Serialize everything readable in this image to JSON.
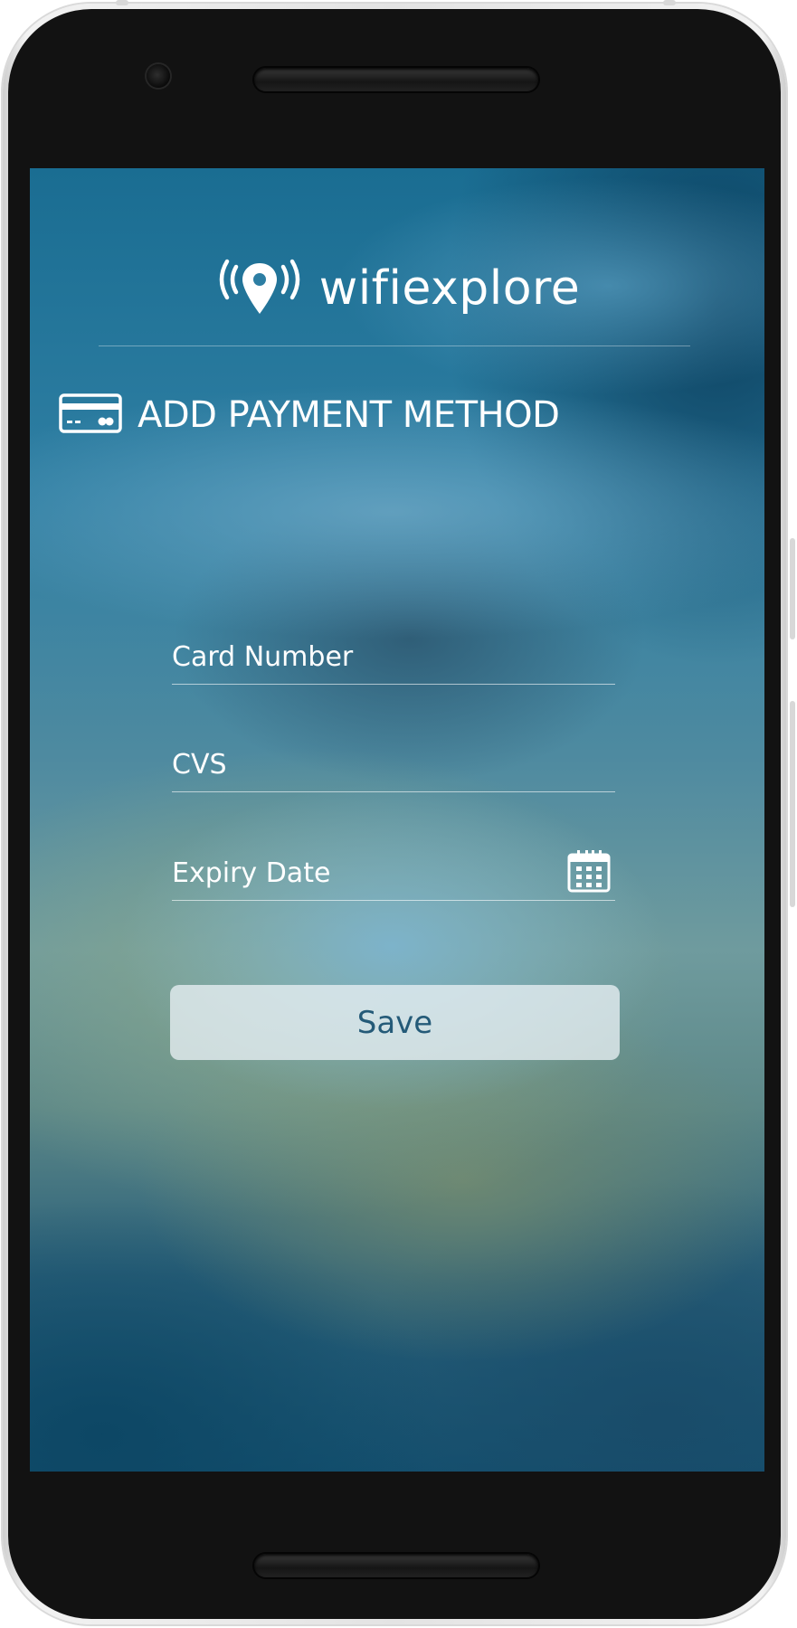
{
  "app": {
    "name": "wifiexplore"
  },
  "header": {
    "title": "ADD PAYMENT METHOD",
    "icon": "credit-card-icon"
  },
  "form": {
    "card_number": {
      "placeholder": "Card Number",
      "value": ""
    },
    "cvs": {
      "placeholder": "CVS",
      "value": ""
    },
    "expiry_date": {
      "placeholder": "Expiry Date",
      "value": "",
      "icon": "calendar-icon"
    }
  },
  "actions": {
    "save_label": "Save"
  },
  "colors": {
    "text": "#ffffff",
    "button_text": "#245a78",
    "button_bg": "#e8f0f4"
  }
}
